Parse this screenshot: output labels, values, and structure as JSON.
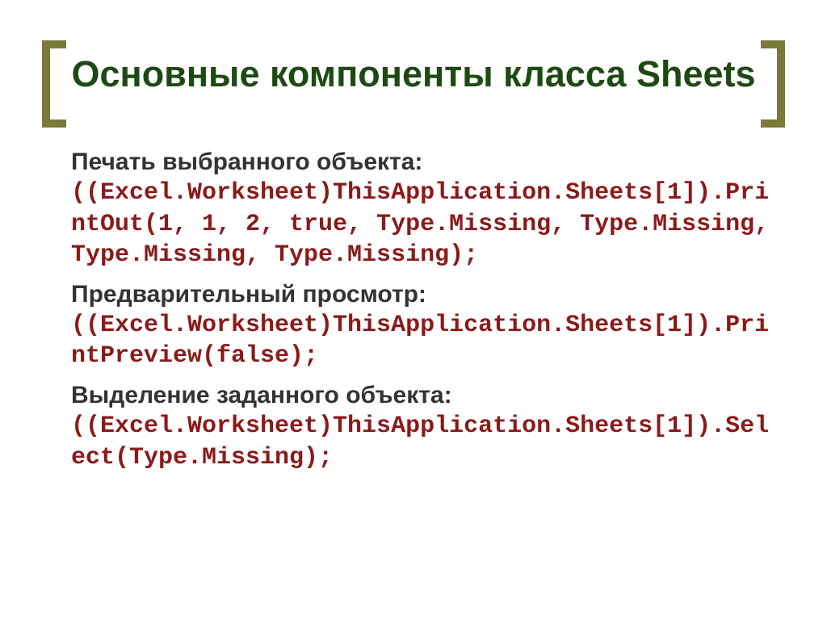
{
  "title": "Основные компоненты класса Sheets",
  "sections": [
    {
      "label": "Печать выбранного объекта:",
      "code": "((Excel.Worksheet)ThisApplication.Sheets[1]).PrintOut(1, 1, 2, true, Type.Missing, Type.Missing, Type.Missing, Type.Missing);"
    },
    {
      "label": "Предварительный просмотр:",
      "code": "((Excel.Worksheet)ThisApplication.Sheets[1]).PrintPreview(false);"
    },
    {
      "label": "Выделение заданного объекта:",
      "code": "((Excel.Worksheet)ThisApplication.Sheets[1]).Select(Type.Missing);"
    }
  ]
}
